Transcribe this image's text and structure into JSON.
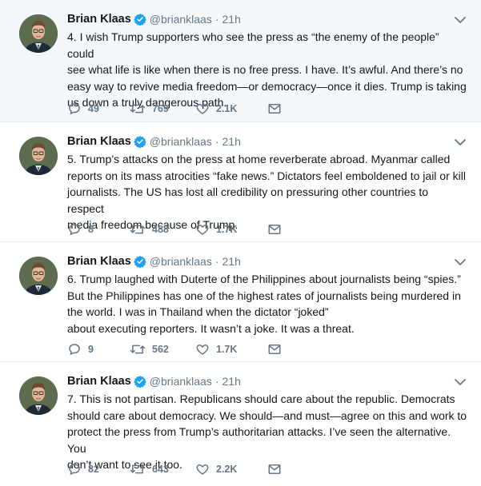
{
  "author": {
    "name": "Brian Klaas",
    "handle": "@brianklaas",
    "time": "21h"
  },
  "colors": {
    "accent": "#1da1f2",
    "muted": "#657786",
    "text": "#14171a",
    "first_bg": "#f5f8fa"
  },
  "icons": {
    "reply": "reply-icon",
    "retweet": "retweet-icon",
    "like": "heart-icon",
    "dm": "envelope-icon",
    "verified": "verified-badge-icon",
    "caret": "chevron-down-icon"
  },
  "tweets": [
    {
      "lines": [
        "4. I wish Trump supporters who see the press as “the enemy of the people” could",
        "see what life is like when there is no free press. I have. It’s awful. And there’s no",
        "easy way to revive media freedom—or democracy—once it dies. Trump is taking",
        "us down a truly dangerous path."
      ],
      "replies": "49",
      "retweets": "769",
      "likes": "2.1K"
    },
    {
      "lines": [
        "5. Trump’s attacks on the press at home reverberate abroad. Myanmar called",
        "reports on its mass atrocities “fake news.” Dictators feel emboldened to jail or kill",
        "journalists. The US has lost all credibility on pressuring other countries to respect",
        "media freedom because of Trump."
      ],
      "replies": "8",
      "retweets": "488",
      "likes": "1.7K"
    },
    {
      "lines": [
        "6. Trump laughed with Duterte of the Philippines about journalists being “spies.”",
        "But the Philippines has one of the highest rates of journalists being murdered in",
        "the world. I was in Thailand when the dictator “joked”",
        "about executing reporters. It wasn’t a joke. It was a threat."
      ],
      "replies": "9",
      "retweets": "562",
      "likes": "1.7K"
    },
    {
      "lines": [
        "7. This is not partisan. Republicans should care about the republic. Democrats",
        "should care about democracy. We should—and must—agree on this and work to",
        "protect the press from Trump’s authoritarian attacks. I’ve seen the alternative. You",
        "don’t want to see it too."
      ],
      "replies": "82",
      "retweets": "643",
      "likes": "2.2K"
    }
  ]
}
